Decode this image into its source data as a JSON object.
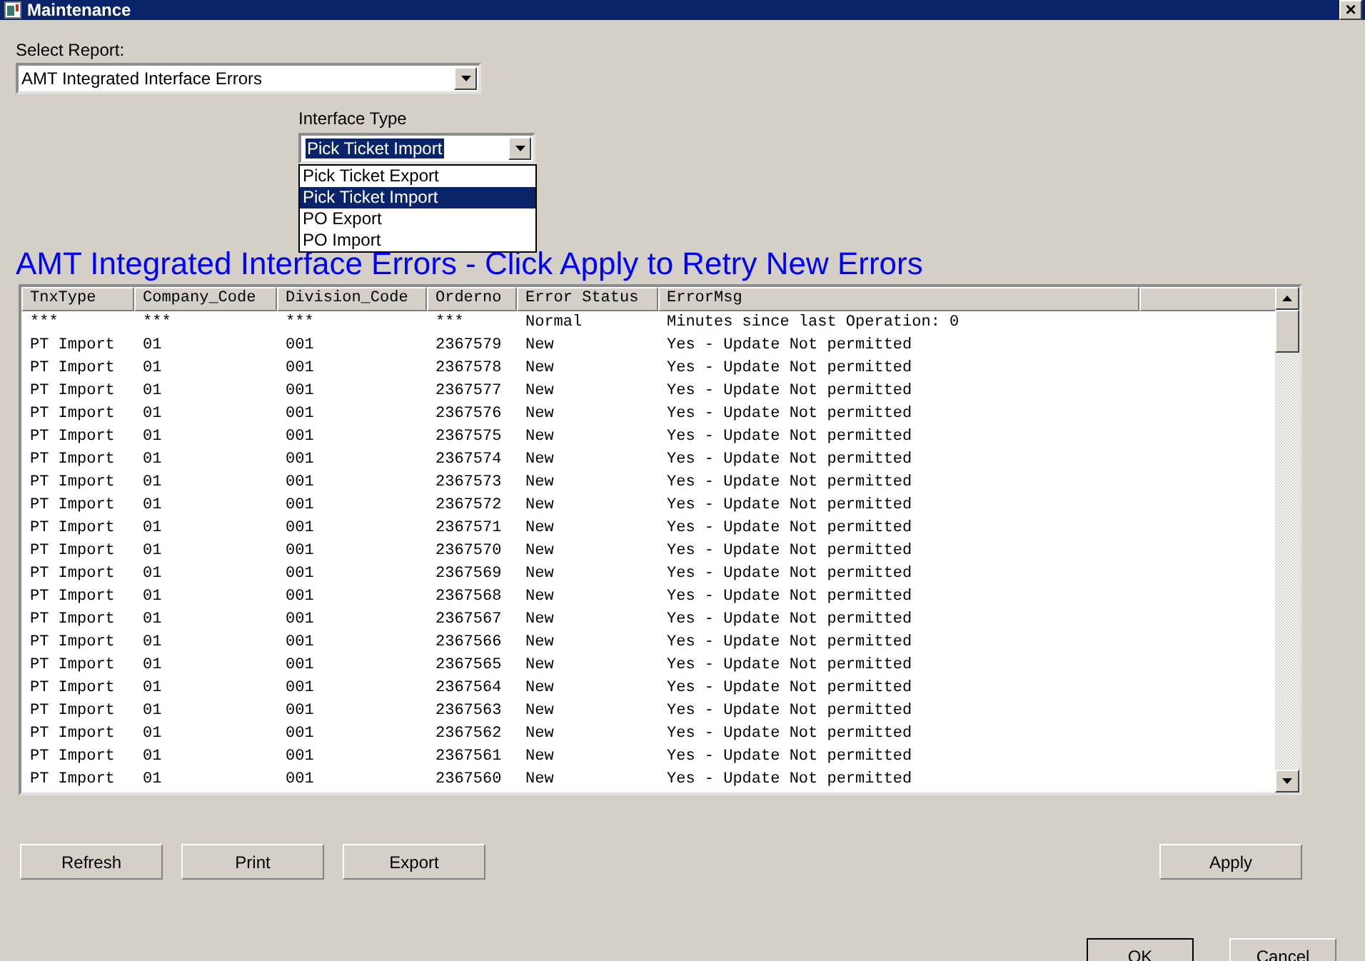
{
  "window": {
    "title": "Maintenance",
    "close": "×"
  },
  "select_report": {
    "label": "Select Report:",
    "value": "AMT Integrated Interface Errors"
  },
  "interface_type": {
    "label": "Interface Type",
    "value": "Pick Ticket Import",
    "options": [
      {
        "label": "Pick Ticket Export",
        "selected": false
      },
      {
        "label": "Pick Ticket Import",
        "selected": true
      },
      {
        "label": "PO Export",
        "selected": false
      },
      {
        "label": "PO Import",
        "selected": false
      }
    ]
  },
  "heading": "AMT Integrated Interface Errors - Click Apply to Retry New Errors",
  "table": {
    "columns": [
      "TnxType",
      "Company_Code",
      "Division_Code",
      "Orderno",
      "Error Status",
      "ErrorMsg"
    ],
    "rows": [
      [
        "***",
        "***",
        "***",
        "***",
        "Normal",
        "Minutes since last Operation: 0"
      ],
      [
        "PT Import",
        "01",
        "001",
        "2367579",
        "New",
        "Yes - Update Not permitted"
      ],
      [
        "PT Import",
        "01",
        "001",
        "2367578",
        "New",
        "Yes - Update Not permitted"
      ],
      [
        "PT Import",
        "01",
        "001",
        "2367577",
        "New",
        "Yes - Update Not permitted"
      ],
      [
        "PT Import",
        "01",
        "001",
        "2367576",
        "New",
        "Yes - Update Not permitted"
      ],
      [
        "PT Import",
        "01",
        "001",
        "2367575",
        "New",
        "Yes - Update Not permitted"
      ],
      [
        "PT Import",
        "01",
        "001",
        "2367574",
        "New",
        "Yes - Update Not permitted"
      ],
      [
        "PT Import",
        "01",
        "001",
        "2367573",
        "New",
        "Yes - Update Not permitted"
      ],
      [
        "PT Import",
        "01",
        "001",
        "2367572",
        "New",
        "Yes - Update Not permitted"
      ],
      [
        "PT Import",
        "01",
        "001",
        "2367571",
        "New",
        "Yes - Update Not permitted"
      ],
      [
        "PT Import",
        "01",
        "001",
        "2367570",
        "New",
        "Yes - Update Not permitted"
      ],
      [
        "PT Import",
        "01",
        "001",
        "2367569",
        "New",
        "Yes - Update Not permitted"
      ],
      [
        "PT Import",
        "01",
        "001",
        "2367568",
        "New",
        "Yes - Update Not permitted"
      ],
      [
        "PT Import",
        "01",
        "001",
        "2367567",
        "New",
        "Yes - Update Not permitted"
      ],
      [
        "PT Import",
        "01",
        "001",
        "2367566",
        "New",
        "Yes - Update Not permitted"
      ],
      [
        "PT Import",
        "01",
        "001",
        "2367565",
        "New",
        "Yes - Update Not permitted"
      ],
      [
        "PT Import",
        "01",
        "001",
        "2367564",
        "New",
        "Yes - Update Not permitted"
      ],
      [
        "PT Import",
        "01",
        "001",
        "2367563",
        "New",
        "Yes - Update Not permitted"
      ],
      [
        "PT Import",
        "01",
        "001",
        "2367562",
        "New",
        "Yes - Update Not permitted"
      ],
      [
        "PT Import",
        "01",
        "001",
        "2367561",
        "New",
        "Yes - Update Not permitted"
      ],
      [
        "PT Import",
        "01",
        "001",
        "2367560",
        "New",
        "Yes - Update Not permitted"
      ]
    ]
  },
  "action_buttons": [
    "Refresh",
    "Print",
    "Export"
  ],
  "apply_button": "Apply",
  "dialog_buttons": [
    "OK",
    "Cancel"
  ]
}
